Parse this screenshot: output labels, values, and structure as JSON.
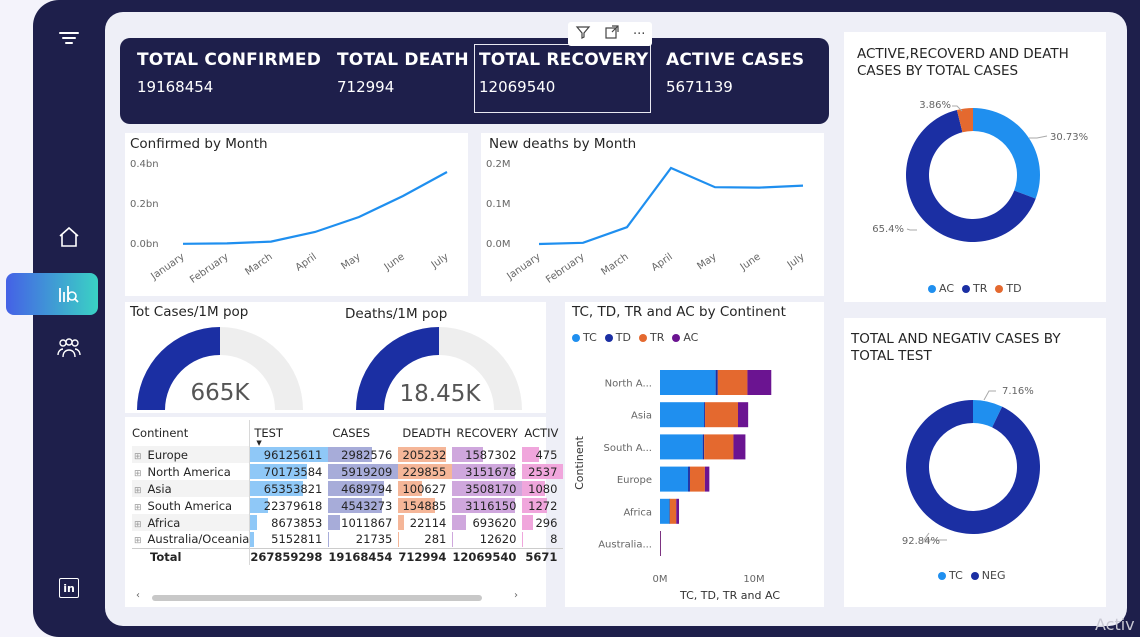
{
  "kpis": [
    {
      "label": "TOTAL CONFIRMED",
      "value": "19168454"
    },
    {
      "label": "TOTAL DEATH",
      "value": "712994"
    },
    {
      "label": "TOTAL RECOVERY",
      "value": "12069540"
    },
    {
      "label": "ACTIVE CASES",
      "value": "5671139"
    }
  ],
  "toolbar": {
    "filter_icon": "filter-icon",
    "focus_icon": "focus-mode-icon",
    "more_label": "···"
  },
  "sidebar": {
    "icons": [
      "menu-icon",
      "home-icon",
      "analytics-icon",
      "people-icon",
      "linkedin-icon"
    ],
    "linkedin_label": "in"
  },
  "confirmed_chart": {
    "title": "Confirmed by Month",
    "chart_data": {
      "type": "line",
      "categories": [
        "January",
        "February",
        "March",
        "April",
        "May",
        "June",
        "July"
      ],
      "values": [
        0.001,
        0.003,
        0.012,
        0.06,
        0.135,
        0.24,
        0.36
      ],
      "y_ticks": [
        "0.0bn",
        "0.2bn",
        "0.4bn"
      ],
      "ylim": [
        0,
        0.4
      ],
      "color": "#1f8fef"
    }
  },
  "deaths_chart": {
    "title": "New deaths by Month",
    "chart_data": {
      "type": "line",
      "categories": [
        "January",
        "February",
        "March",
        "April",
        "May",
        "June",
        "July"
      ],
      "values": [
        0.0,
        0.003,
        0.042,
        0.19,
        0.142,
        0.141,
        0.146
      ],
      "y_ticks": [
        "0.0M",
        "0.1M",
        "0.2M"
      ],
      "ylim": [
        0,
        0.2
      ],
      "color": "#1f8fef"
    }
  },
  "gauges": [
    {
      "title": "Tot Cases/1M pop",
      "value_label": "665K",
      "fill": 0.5,
      "color": "#1b2fa3"
    },
    {
      "title": "Deaths/1M pop",
      "value_label": "18.45K",
      "fill": 0.5,
      "color": "#1b2fa3"
    }
  ],
  "matrix": {
    "headers": [
      "Continent",
      "TEST",
      "CASES",
      "DEADTH",
      "RECOVERY",
      "ACTIV"
    ],
    "rows": [
      {
        "name": "Europe",
        "test": "96125611",
        "cases": "2982576",
        "death": "205232",
        "recovery": "1587302",
        "active": "475",
        "tf": 1.0,
        "cf": 0.62,
        "df": 0.89,
        "rf": 0.44,
        "af": 0.4
      },
      {
        "name": "North America",
        "test": "70173584",
        "cases": "5919209",
        "death": "229855",
        "recovery": "3151678",
        "active": "2537",
        "tf": 0.73,
        "cf": 1.0,
        "df": 1.0,
        "rf": 0.9,
        "af": 1.0
      },
      {
        "name": "Asia",
        "test": "65353821",
        "cases": "4689794",
        "death": "100627",
        "recovery": "3508170",
        "active": "1080",
        "tf": 0.68,
        "cf": 0.8,
        "df": 0.44,
        "rf": 1.0,
        "af": 0.55
      },
      {
        "name": "South America",
        "test": "22379618",
        "cases": "4543273",
        "death": "154885",
        "recovery": "3116150",
        "active": "1272",
        "tf": 0.23,
        "cf": 0.77,
        "df": 0.67,
        "rf": 0.89,
        "af": 0.6
      },
      {
        "name": "Africa",
        "test": "8673853",
        "cases": "1011867",
        "death": "22114",
        "recovery": "693620",
        "active": "296",
        "tf": 0.09,
        "cf": 0.17,
        "df": 0.1,
        "rf": 0.2,
        "af": 0.25
      },
      {
        "name": "Australia/Oceania",
        "test": "5152811",
        "cases": "21735",
        "death": "281",
        "recovery": "12620",
        "active": "8",
        "tf": 0.05,
        "cf": 0.01,
        "df": 0.01,
        "rf": 0.01,
        "af": 0.02
      }
    ],
    "total": {
      "name": "Total",
      "test": "267859298",
      "cases": "19168454",
      "death": "712994",
      "recovery": "12069540",
      "active": "5671"
    },
    "expand_icon": "⊞"
  },
  "continent_chart": {
    "title": "TC, TD, TR and AC by Continent",
    "ylabel": "Continent",
    "xlabel": "TC, TD, TR and AC",
    "legend": [
      {
        "name": "TC",
        "color": "#1f8fef"
      },
      {
        "name": "TD",
        "color": "#1b2fa3"
      },
      {
        "name": "TR",
        "color": "#e4692f"
      },
      {
        "name": "AC",
        "color": "#6b1491"
      }
    ],
    "chart_data": {
      "type": "bar",
      "orientation": "horizontal",
      "stacked": true,
      "categories": [
        "North A...",
        "Asia",
        "South A...",
        "Europe",
        "Africa",
        "Australia..."
      ],
      "series": [
        {
          "name": "TC",
          "values": [
            5919209,
            4689794,
            4543273,
            2982576,
            1011867,
            21735
          ]
        },
        {
          "name": "TD",
          "values": [
            229855,
            100627,
            154885,
            205232,
            22114,
            281
          ]
        },
        {
          "name": "TR",
          "values": [
            3151678,
            3508170,
            3116150,
            1587302,
            693620,
            12620
          ]
        },
        {
          "name": "AC",
          "values": [
            2537000,
            1080000,
            1272000,
            475000,
            296000,
            8000
          ]
        }
      ],
      "x_ticks": [
        "0M",
        "10M"
      ],
      "xlim": [
        0,
        15000000
      ]
    }
  },
  "donut_top": {
    "title": "ACTIVE,RECOVERD AND DEATH CASES BY TOTAL CASES",
    "chart_data": {
      "type": "pie",
      "donut": true,
      "slices": [
        {
          "name": "AC",
          "value": 30.73,
          "label": "30.73%",
          "color": "#1f8fef"
        },
        {
          "name": "TR",
          "value": 65.4,
          "label": "65.4%",
          "color": "#1b2fa3"
        },
        {
          "name": "TD",
          "value": 3.86,
          "label": "3.86%",
          "color": "#e4692f"
        }
      ]
    }
  },
  "donut_bottom": {
    "title": "TOTAL AND NEGATIV CASES BY TOTAL TEST",
    "chart_data": {
      "type": "pie",
      "donut": true,
      "slices": [
        {
          "name": "TC",
          "value": 7.16,
          "label": "7.16%",
          "color": "#1f8fef"
        },
        {
          "name": "NEG",
          "value": 92.84,
          "label": "92.84%",
          "color": "#1b2fa3"
        }
      ]
    }
  },
  "watermark": "Activ"
}
